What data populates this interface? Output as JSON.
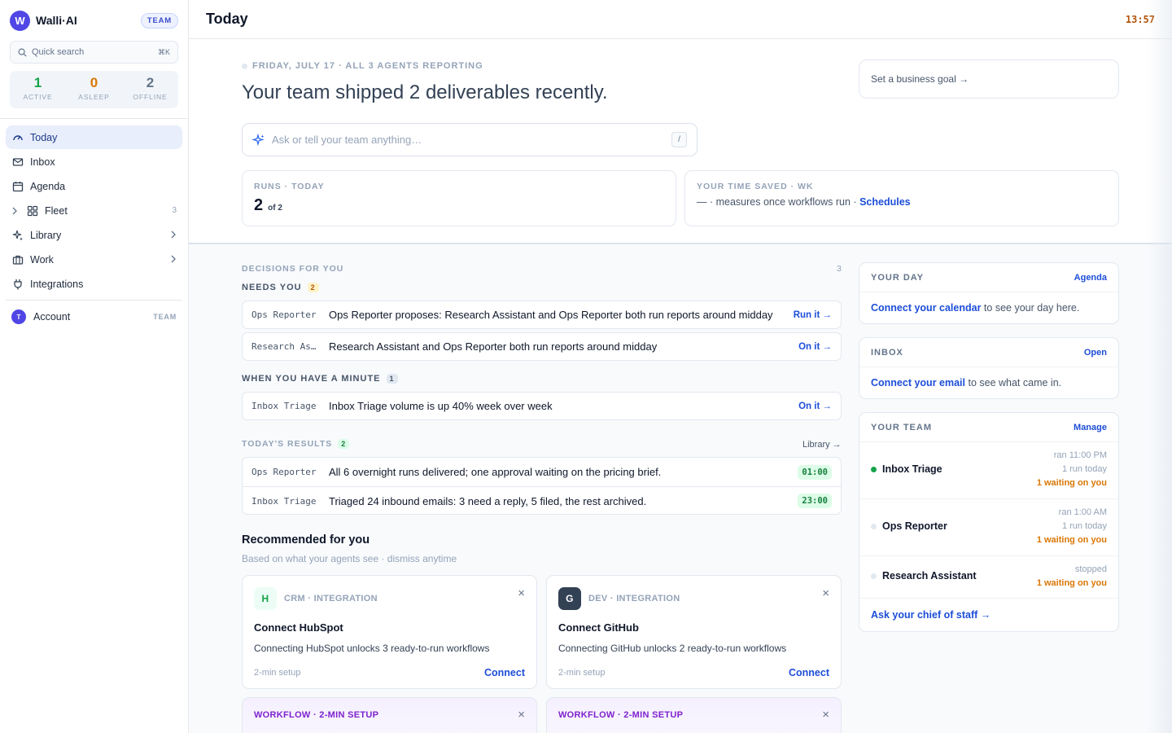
{
  "brand": {
    "logo_letter": "W",
    "name": "Walli·AI",
    "plan_badge": "TEAM"
  },
  "search": {
    "placeholder": "Quick search",
    "shortcut": "⌘K"
  },
  "status": [
    {
      "value": "1",
      "label": "ACTIVE",
      "color": "#16a34a"
    },
    {
      "value": "0",
      "label": "ASLEEP",
      "color": "#d97706"
    },
    {
      "value": "2",
      "label": "OFFLINE",
      "color": "#64748b"
    }
  ],
  "nav": {
    "today": "Today",
    "inbox": "Inbox",
    "agenda": "Agenda",
    "fleet": "Fleet",
    "fleet_count": "3",
    "library": "Library",
    "work": "Work",
    "integrations": "Integrations"
  },
  "account": {
    "initial": "T",
    "label": "Account",
    "tag": "TEAM"
  },
  "topbar": {
    "title": "Today",
    "clock": "13:57"
  },
  "hero": {
    "date_line": "FRIDAY, JULY 17 · ALL 3 AGENTS REPORTING",
    "headline": "Your team shipped 2 deliverables recently.",
    "goal_button": "Set a business goal →",
    "ask_placeholder": "Ask or tell your team anything…",
    "ask_shortcut": "/"
  },
  "metrics": {
    "runs": {
      "label": "RUNS · TODAY",
      "value": "2",
      "of": "of 2"
    },
    "time_saved": {
      "label": "YOUR TIME SAVED · WK",
      "text": "— · measures once workflows run ·",
      "link": "Schedules"
    }
  },
  "decisions": {
    "title": "DECISIONS FOR YOU",
    "count": "3",
    "needs_you": {
      "label": "NEEDS YOU",
      "count": "2"
    },
    "needs_items": [
      {
        "agent": "Ops Reporter",
        "message": "Ops Reporter proposes: Research Assistant and Ops Reporter both run reports around midday",
        "action": "Run it →"
      },
      {
        "agent": "Research As…",
        "message": "Research Assistant and Ops Reporter both run reports around midday",
        "action": "On it →"
      }
    ],
    "minute": {
      "label": "WHEN YOU HAVE A MINUTE",
      "count": "1"
    },
    "minute_items": [
      {
        "agent": "Inbox Triage",
        "message": "Inbox Triage volume is up 40% week over week",
        "action": "On it →"
      }
    ]
  },
  "results": {
    "label": "TODAY'S RESULTS",
    "count": "2",
    "link": "Library →",
    "items": [
      {
        "agent": "Ops Reporter",
        "message": "All 6 overnight runs delivered; one approval waiting on the pricing brief.",
        "time": "01:00"
      },
      {
        "agent": "Inbox Triage",
        "message": "Triaged 24 inbound emails: 3 need a reply, 5 filed, the rest archived.",
        "time": "23:00"
      }
    ]
  },
  "recommended": {
    "title": "Recommended for you",
    "subtitle": "Based on what your agents see · dismiss anytime",
    "cards": [
      {
        "logo": "H",
        "category": "CRM · INTEGRATION",
        "name": "Connect HubSpot",
        "desc": "Connecting HubSpot unlocks 3 ready-to-run workflows",
        "setup": "2-min setup",
        "action": "Connect"
      },
      {
        "logo": "G",
        "category": "DEV · INTEGRATION",
        "name": "Connect GitHub",
        "desc": "Connecting GitHub unlocks 2 ready-to-run workflows",
        "setup": "2-min setup",
        "action": "Connect"
      }
    ],
    "workflows": [
      {
        "category": "WORKFLOW · 2-MIN SETUP"
      },
      {
        "category": "WORKFLOW · 2-MIN SETUP"
      }
    ],
    "close_glyph": "×"
  },
  "your_day": {
    "title": "YOUR DAY",
    "action": "Agenda",
    "link": "Connect your calendar",
    "text": " to see your day here."
  },
  "inbox_card": {
    "title": "INBOX",
    "action": "Open",
    "link": "Connect your email",
    "text": " to see what came in."
  },
  "your_team": {
    "title": "YOUR TEAM",
    "action": "Manage",
    "members": [
      {
        "name": "Inbox Triage",
        "last_run": "ran 11:00 PM",
        "runs": "1 run today",
        "waiting": "1 waiting on you",
        "dot_color": "#16a34a"
      },
      {
        "name": "Ops Reporter",
        "last_run": "ran 1:00 AM",
        "runs": "1 run today",
        "waiting": "1 waiting on you",
        "dot_color": "#e2e8f0"
      },
      {
        "name": "Research Assistant",
        "last_run": "stopped",
        "waiting": "1 waiting on you",
        "dot_color": "#e2e8f0"
      }
    ],
    "chief_link": "Ask your chief of staff →"
  }
}
